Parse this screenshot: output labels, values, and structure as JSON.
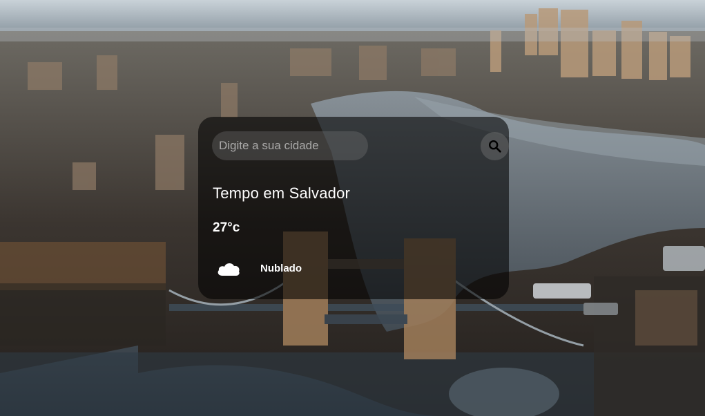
{
  "search": {
    "placeholder": "Digite a sua cidade",
    "button_icon": "search-icon"
  },
  "weather": {
    "title": "Tempo em Salvador",
    "temperature": "27°c",
    "condition": "Nublado",
    "condition_icon": "cloud-icon"
  },
  "background": {
    "description_icon": "city-river-photo",
    "accent_colors": [
      "#d6a56a",
      "#1f2730",
      "#2c3b4a"
    ]
  }
}
